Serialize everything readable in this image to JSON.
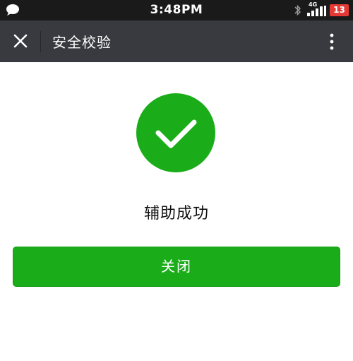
{
  "status_bar": {
    "time": "3:48PM",
    "network_label": "4G",
    "battery_level": "13",
    "notification_icon": "chat-bubble-icon",
    "bluetooth_icon": "bluetooth-icon",
    "signal_icon": "signal-bars-icon"
  },
  "title_bar": {
    "title": "安全校验",
    "close_icon": "close-icon",
    "more_icon": "more-vertical-icon"
  },
  "result": {
    "icon": "check-icon",
    "message": "辅助成功"
  },
  "actions": {
    "close_label": "关闭"
  },
  "colors": {
    "status_bar_bg": "#1a1a1a",
    "title_bar_bg": "#393a3f",
    "accent_green": "#1aad19",
    "battery_red": "#e53935"
  }
}
